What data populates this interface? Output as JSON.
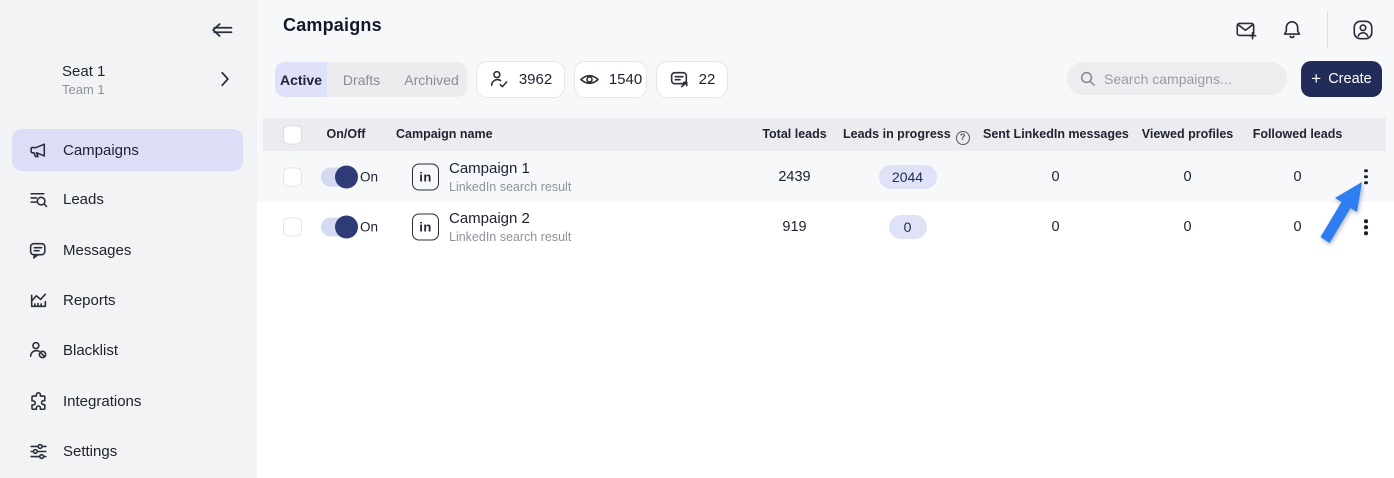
{
  "sidebar": {
    "seat": {
      "title": "Seat 1",
      "subtitle": "Team 1"
    },
    "items": [
      {
        "label": "Campaigns",
        "icon": "megaphone-icon",
        "active": true
      },
      {
        "label": "Leads",
        "icon": "lead-search-icon",
        "active": false
      },
      {
        "label": "Messages",
        "icon": "chat-bubble-icon",
        "active": false
      },
      {
        "label": "Reports",
        "icon": "chart-icon",
        "active": false
      },
      {
        "label": "Blacklist",
        "icon": "person-blocked-icon",
        "active": false
      },
      {
        "label": "Integrations",
        "icon": "puzzle-icon",
        "active": false
      },
      {
        "label": "Settings",
        "icon": "sliders-icon",
        "active": false
      }
    ]
  },
  "header": {
    "title": "Campaigns"
  },
  "toolbar": {
    "tabs": [
      {
        "label": "Active",
        "selected": true
      },
      {
        "label": "Drafts",
        "selected": false
      },
      {
        "label": "Archived",
        "selected": false
      }
    ],
    "stats": [
      {
        "icon": "person-check-icon",
        "value": "3962"
      },
      {
        "icon": "eye-icon",
        "value": "1540"
      },
      {
        "icon": "message-forward-icon",
        "value": "22"
      }
    ],
    "search_placeholder": "Search campaigns...",
    "create_label": "Create",
    "create_plus": "+"
  },
  "table": {
    "columns": [
      "On/Off",
      "Campaign name",
      "Total leads",
      "Leads in progress",
      "Sent LinkedIn messages",
      "Viewed profiles",
      "Followed leads"
    ],
    "rows": [
      {
        "toggle": "On",
        "source_icon": "linkedin-icon",
        "source_label": "in",
        "name": "Campaign 1",
        "type": "LinkedIn search result",
        "total_leads": "2439",
        "leads_in_progress": "2044",
        "sent_messages": "0",
        "viewed_profiles": "0",
        "followed_leads": "0"
      },
      {
        "toggle": "On",
        "source_icon": "linkedin-icon",
        "source_label": "in",
        "name": "Campaign 2",
        "type": "LinkedIn search result",
        "total_leads": "919",
        "leads_in_progress": "0",
        "sent_messages": "0",
        "viewed_profiles": "0",
        "followed_leads": "0"
      }
    ]
  },
  "annotation": {
    "shape": "cursor-arrow",
    "color": "#2e7ef2"
  },
  "colors": {
    "sidebar_bg": "#f2f3f5",
    "sidebar_active": "#dbdef6",
    "top_band": "#f7f8fa",
    "table_header": "#ececf0",
    "navy": "#222c59",
    "tab_active": "#dee1f7",
    "badge": "#e0e3f8",
    "toggle_track": "#d5d9f1",
    "toggle_knob": "#2e3b76",
    "arrow_blue": "#2e7ef2"
  }
}
